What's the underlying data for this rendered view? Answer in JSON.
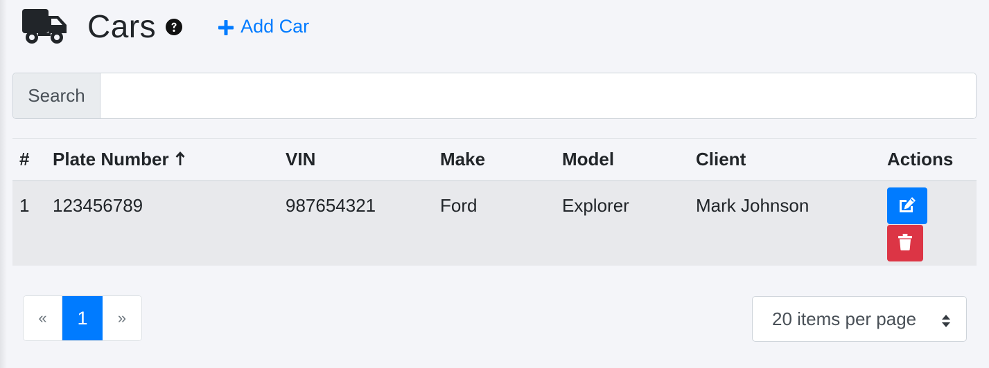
{
  "header": {
    "title": "Cars",
    "add_label": "Add Car"
  },
  "search": {
    "label": "Search",
    "value": "",
    "placeholder": ""
  },
  "table": {
    "columns": [
      "#",
      "Plate Number",
      "VIN",
      "Make",
      "Model",
      "Client",
      "Actions"
    ],
    "sort_column": "Plate Number",
    "sort_direction": "ascending",
    "rows": [
      {
        "index": "1",
        "plate_number": "123456789",
        "vin": "987654321",
        "make": "Ford",
        "model": "Explorer",
        "client": "Mark Johnson"
      }
    ]
  },
  "pagination": {
    "prev": "«",
    "current": "1",
    "next": "»"
  },
  "per_page": {
    "selected": "20 items per page"
  },
  "icons": {
    "logo": "truck-icon",
    "help": "question-circle-icon",
    "add": "plus-icon",
    "sort": "arrow-up-icon",
    "edit": "edit-icon",
    "delete": "trash-icon",
    "select": "sort-caret-icon"
  },
  "colors": {
    "primary": "#007bff",
    "danger": "#dc3545",
    "background": "#f4f5f9"
  }
}
